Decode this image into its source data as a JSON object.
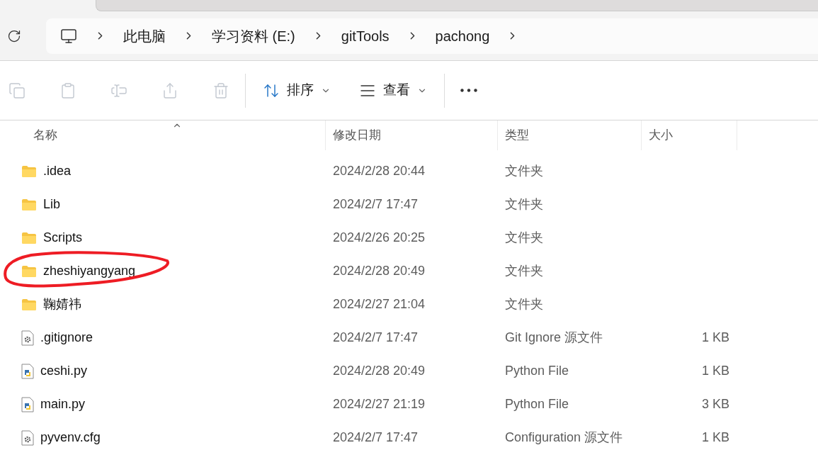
{
  "address_bar": {
    "crumbs": [
      {
        "label": "此电脑"
      },
      {
        "label": "学习资料 (E:)"
      },
      {
        "label": "gitTools"
      },
      {
        "label": "pachong"
      }
    ]
  },
  "toolbar": {
    "groups": [
      [
        {
          "kind": "copy",
          "disabled": true
        },
        {
          "kind": "paste",
          "disabled": true
        },
        {
          "kind": "rename",
          "disabled": true
        },
        {
          "kind": "share",
          "disabled": true
        },
        {
          "kind": "delete",
          "disabled": true
        }
      ],
      [
        {
          "kind": "sort",
          "label": "排序",
          "disabled": false
        },
        {
          "kind": "view",
          "label": "查看",
          "disabled": false
        }
      ],
      [
        {
          "kind": "more",
          "disabled": false
        }
      ]
    ]
  },
  "table": {
    "columns": [
      {
        "label": "名称",
        "sorted": true
      },
      {
        "label": "修改日期",
        "sorted": false
      },
      {
        "label": "类型",
        "sorted": false
      },
      {
        "label": "大小",
        "sorted": false
      }
    ],
    "rows": [
      {
        "kind": "folder",
        "name": ".idea",
        "date": "2024/2/28 20:44",
        "type": "文件夹",
        "circled": false
      },
      {
        "kind": "folder",
        "name": "Lib",
        "date": "2024/2/7 17:47",
        "type": "文件夹",
        "circled": false
      },
      {
        "kind": "folder",
        "name": "Scripts",
        "date": "2024/2/26 20:25",
        "type": "文件夹",
        "circled": false
      },
      {
        "kind": "folder",
        "name": "zheshiyangyang",
        "date": "2024/2/28 20:49",
        "type": "文件夹",
        "circled": true
      },
      {
        "kind": "folder",
        "name": "鞠婧祎",
        "date": "2024/2/27 21:04",
        "type": "文件夹",
        "circled": false
      },
      {
        "kind": "config",
        "name": ".gitignore",
        "date": "2024/2/7 17:47",
        "type": "Git Ignore 源文件",
        "size": "1 KB",
        "circled": false
      },
      {
        "kind": "python",
        "name": "ceshi.py",
        "date": "2024/2/28 20:49",
        "type": "Python File",
        "size": "1 KB",
        "circled": false
      },
      {
        "kind": "python",
        "name": "main.py",
        "date": "2024/2/27 21:19",
        "type": "Python File",
        "size": "3 KB",
        "circled": false
      },
      {
        "kind": "config",
        "name": "pyvenv.cfg",
        "date": "2024/2/7 17:47",
        "type": "Configuration 源文件",
        "size": "1 KB",
        "circled": false
      }
    ]
  }
}
